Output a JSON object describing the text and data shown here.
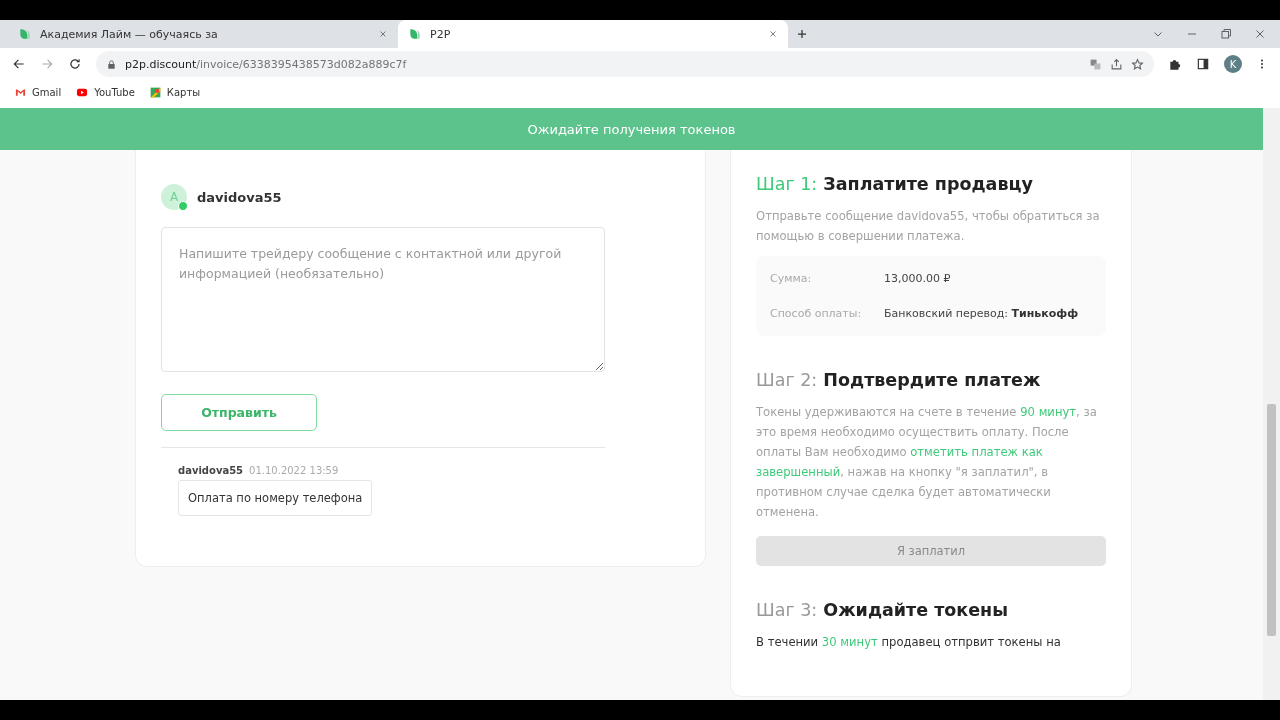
{
  "browser": {
    "tabs": [
      {
        "title": "Академия Лайм — обучаясь за",
        "selected": false
      },
      {
        "title": "P2P",
        "selected": true
      }
    ],
    "url": {
      "domain": "p2p.discount",
      "path": "/invoice/6338395438573d082a889c7f"
    },
    "profile_initial": "K",
    "bookmarks": [
      {
        "label": "Gmail",
        "kind": "gmail"
      },
      {
        "label": "YouTube",
        "kind": "youtube"
      },
      {
        "label": "Карты",
        "kind": "maps"
      }
    ]
  },
  "banner": {
    "text": "Ожидайте получения токенов"
  },
  "chat": {
    "avatar_letter": "A",
    "online": true,
    "username": "davidova55",
    "message_field": {
      "placeholder": "Напишите трейдеру сообщение с контактной или другой информацией (необязательно)"
    },
    "send_button": "Отправить",
    "messages": [
      {
        "author": "davidova55",
        "time": "01.10.2022 13:59",
        "text": "Оплата по номеру телефона"
      }
    ]
  },
  "steps": [
    {
      "label": "Шаг 1:",
      "title": "Заплатите продавцу",
      "active": true,
      "parts": [
        {
          "text": "Отправьте сообщение davidova55, чтобы обратиться за помощью в совершении платежа.",
          "highlight": false
        }
      ],
      "details": [
        {
          "label": "Сумма:",
          "value": "13,000.00 ₽"
        },
        {
          "label": "Способ оплаты:",
          "value": "Банковский перевод:",
          "value_strong": "Тинькофф"
        }
      ]
    },
    {
      "label": "Шаг 2:",
      "title": "Подтвердите платеж",
      "active": false,
      "parts": [
        {
          "text": "Токены удерживаются на счете в течение ",
          "highlight": false
        },
        {
          "text": "90 минут",
          "highlight": true
        },
        {
          "text": ", за это время необходимо осуществить оплату. После оплаты Вам необходимо ",
          "highlight": false
        },
        {
          "text": "отметить платеж как завершенный",
          "highlight": true
        },
        {
          "text": ", нажав на кнопку \"я заплатил\", в противном случае сделка будет автоматически отменена.",
          "highlight": false
        }
      ],
      "button": {
        "label": "Я заплатил",
        "disabled": true
      }
    },
    {
      "label": "Шаг 3:",
      "title": "Ожидайте токены",
      "active": false,
      "parts": [
        {
          "text": "В течении ",
          "highlight": false
        },
        {
          "text": "30 минут",
          "highlight": true
        },
        {
          "text": " продавец отпрвит токены на",
          "highlight": false
        }
      ]
    }
  ]
}
